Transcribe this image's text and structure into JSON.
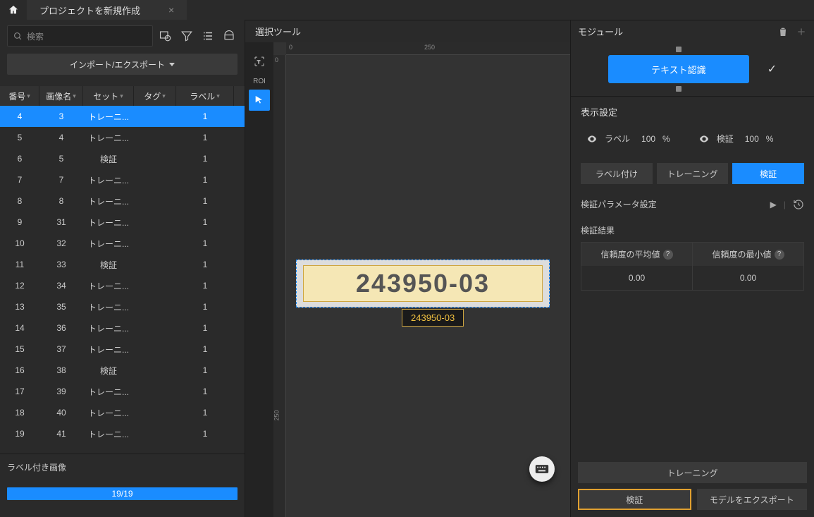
{
  "titlebar": {
    "tab": "プロジェクトを新規作成"
  },
  "left": {
    "search_placeholder": "検索",
    "import_export": "インポート/エクスポート",
    "columns": [
      "番号",
      "画像名",
      "セット",
      "タグ",
      "ラベル"
    ],
    "rows": [
      {
        "no": "4",
        "name": "3",
        "set": "トレーニ...",
        "tag": "",
        "label": "1",
        "selected": true
      },
      {
        "no": "5",
        "name": "4",
        "set": "トレーニ...",
        "tag": "",
        "label": "1"
      },
      {
        "no": "6",
        "name": "5",
        "set": "検証",
        "tag": "",
        "label": "1"
      },
      {
        "no": "7",
        "name": "7",
        "set": "トレーニ...",
        "tag": "",
        "label": "1"
      },
      {
        "no": "8",
        "name": "8",
        "set": "トレーニ...",
        "tag": "",
        "label": "1"
      },
      {
        "no": "9",
        "name": "31",
        "set": "トレーニ...",
        "tag": "",
        "label": "1"
      },
      {
        "no": "10",
        "name": "32",
        "set": "トレーニ...",
        "tag": "",
        "label": "1"
      },
      {
        "no": "11",
        "name": "33",
        "set": "検証",
        "tag": "",
        "label": "1"
      },
      {
        "no": "12",
        "name": "34",
        "set": "トレーニ...",
        "tag": "",
        "label": "1"
      },
      {
        "no": "13",
        "name": "35",
        "set": "トレーニ...",
        "tag": "",
        "label": "1"
      },
      {
        "no": "14",
        "name": "36",
        "set": "トレーニ...",
        "tag": "",
        "label": "1"
      },
      {
        "no": "15",
        "name": "37",
        "set": "トレーニ...",
        "tag": "",
        "label": "1"
      },
      {
        "no": "16",
        "name": "38",
        "set": "検証",
        "tag": "",
        "label": "1"
      },
      {
        "no": "17",
        "name": "39",
        "set": "トレーニ...",
        "tag": "",
        "label": "1"
      },
      {
        "no": "18",
        "name": "40",
        "set": "トレーニ...",
        "tag": "",
        "label": "1"
      },
      {
        "no": "19",
        "name": "41",
        "set": "トレーニ...",
        "tag": "",
        "label": "1"
      }
    ],
    "footer_label": "ラベル付き画像",
    "progress_text": "19/19"
  },
  "center": {
    "header": "選択ツール",
    "roi_label": "ROI",
    "ruler_h": [
      "0",
      "250"
    ],
    "ruler_v": [
      "0",
      "250"
    ],
    "roi_text": "243950-03",
    "detection_label": "243950-03"
  },
  "right": {
    "header": "モジュール",
    "module_name": "テキスト認識",
    "display_section": "表示設定",
    "vis": [
      {
        "label": "ラベル",
        "pct": "100",
        "unit": "%"
      },
      {
        "label": "検証",
        "pct": "100",
        "unit": "%"
      }
    ],
    "tabs": [
      "ラベル付け",
      "トレーニング",
      "検証"
    ],
    "active_tab": 2,
    "param_title": "検証パラメータ設定",
    "result_title": "検証結果",
    "result_headers": [
      "信頼度の平均値",
      "信頼度の最小値"
    ],
    "result_values": [
      "0.00",
      "0.00"
    ],
    "training_btn": "トレーニング",
    "verify_btn": "検証",
    "export_btn": "モデルをエクスポート"
  }
}
